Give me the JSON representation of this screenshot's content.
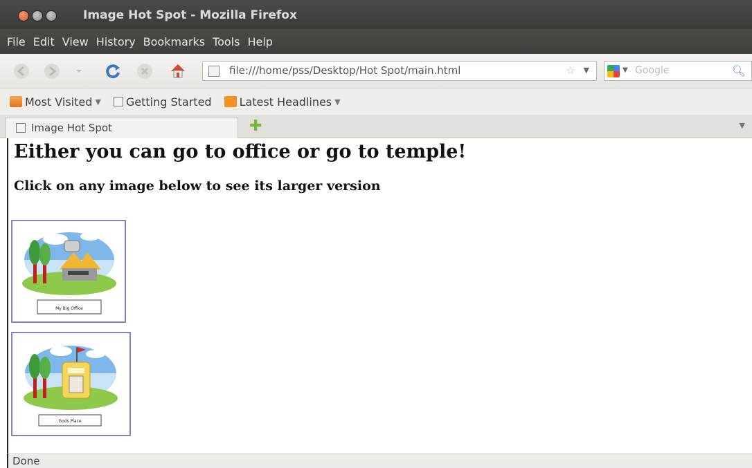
{
  "window": {
    "title": "Image Hot Spot - Mozilla Firefox"
  },
  "menubar": {
    "items": [
      "File",
      "Edit",
      "View",
      "History",
      "Bookmarks",
      "Tools",
      "Help"
    ]
  },
  "navbar": {
    "url": "file:///home/pss/Desktop/Hot Spot/main.html",
    "search_placeholder": "Google"
  },
  "bookmarks": {
    "items": [
      {
        "label": "Most Visited",
        "icon": "folder-icon",
        "dropdown": true
      },
      {
        "label": "Getting Started",
        "icon": "page-icon",
        "dropdown": false
      },
      {
        "label": "Latest Headlines",
        "icon": "rss-icon",
        "dropdown": true
      }
    ]
  },
  "tabs": {
    "active_label": "Image Hot Spot"
  },
  "page": {
    "heading": "Either you can go to office or go to temple!",
    "subheading": "Click on any image below to see its larger version",
    "images": [
      {
        "caption": "My Big Office"
      },
      {
        "caption": "Gods Place"
      }
    ]
  },
  "status": {
    "text": "Done"
  },
  "colors": {
    "titlebar": "#3a3a37",
    "close_button": "#d9562c",
    "thumb_border": "#7b86c0"
  }
}
